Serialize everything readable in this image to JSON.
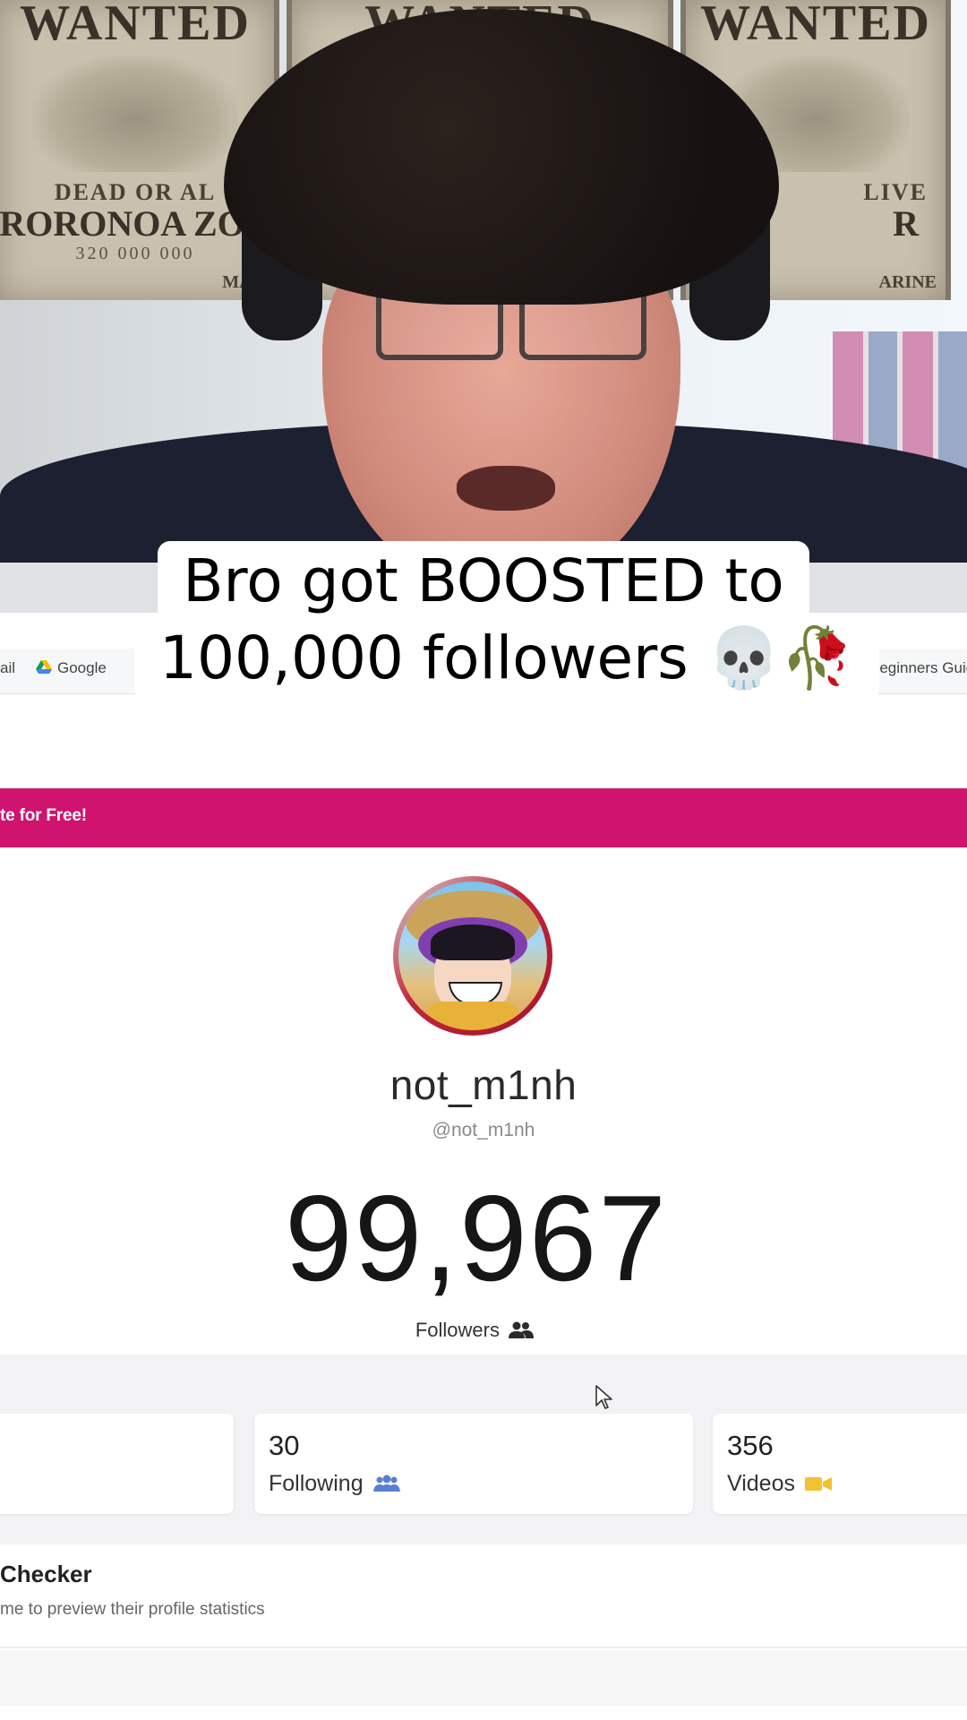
{
  "caption": {
    "line1": "Bro got BOOSTED to",
    "line2": "100,000 followers 💀🥀"
  },
  "webcam": {
    "poster_left": {
      "head": "WANTED",
      "mid": "DEAD OR AL",
      "name": "RORONOA ZOR",
      "bounty": "320 000 000",
      "footer": "MAR"
    },
    "poster_mid": {
      "head": "WANTED"
    },
    "poster_right": {
      "head": "WANTED",
      "mid": "LIVE",
      "name": "R",
      "footer": "ARINE"
    }
  },
  "browser": {
    "bookmarks": [
      {
        "label": "ail"
      },
      {
        "label": "Google",
        "icon": "google-drive-icon"
      },
      {
        "label": "Beginners Guid"
      }
    ]
  },
  "page": {
    "promo_text": "te for Free!",
    "accent_color": "#d0136f",
    "profile": {
      "display_name": "not_m1nh",
      "handle": "@not_m1nh",
      "followers_count": "99,967",
      "followers_label": "Followers"
    },
    "stats": [
      {
        "value": "",
        "label": ""
      },
      {
        "value": "30",
        "label": "Following",
        "icon": "following-icon"
      },
      {
        "value": "356",
        "label": "Videos",
        "icon": "video-camera-icon"
      }
    ],
    "checker": {
      "title": "Checker",
      "subtitle": "me to preview their profile statistics"
    }
  }
}
